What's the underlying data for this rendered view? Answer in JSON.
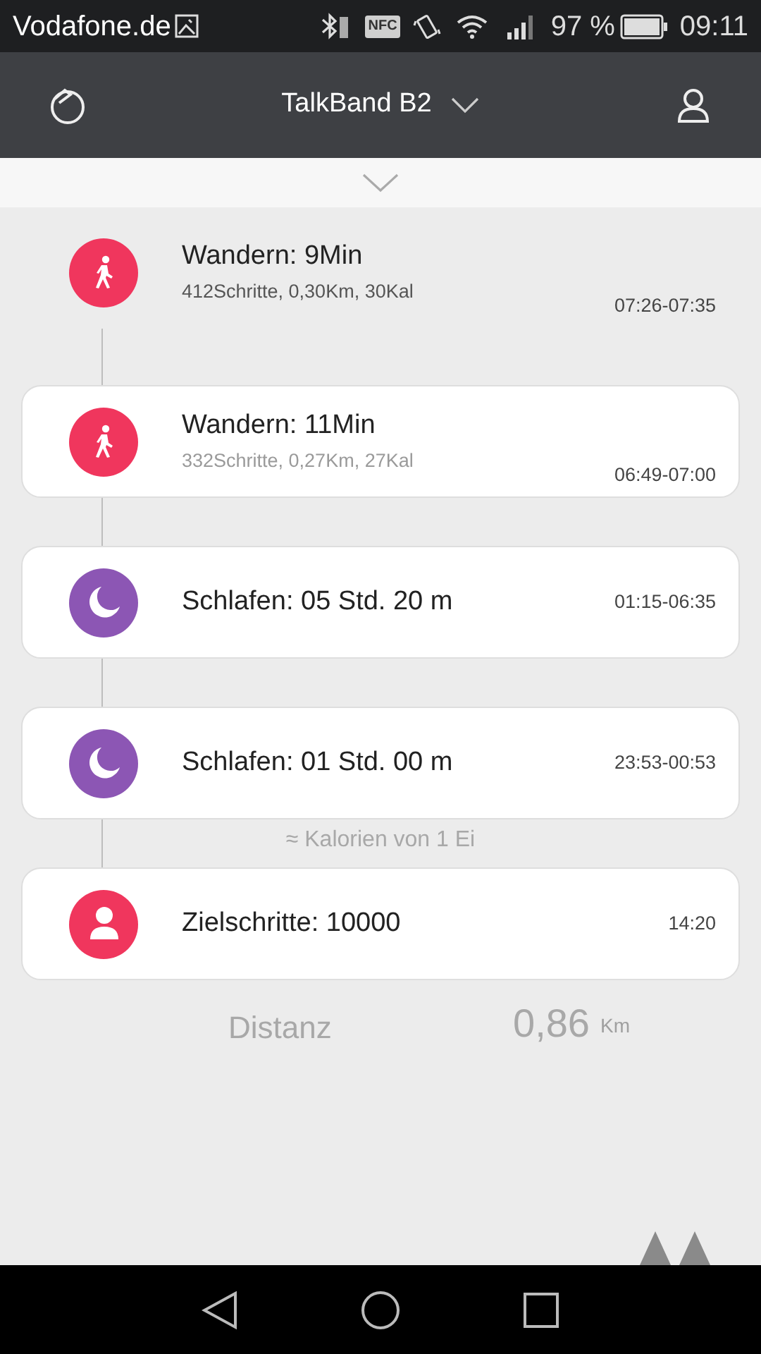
{
  "status_bar": {
    "carrier": "Vodafone.de",
    "nfc_label": "NFC",
    "battery": "97 %",
    "time": "09:11"
  },
  "header": {
    "title": "TalkBand B2"
  },
  "background": {
    "calories_note": "≈ Kalorien von 1 Ei",
    "distance_label": "Distanz",
    "distance_value": "0,86",
    "distance_unit": "Km"
  },
  "timeline": [
    {
      "kind": "walk",
      "carded": false,
      "color": "#f0365d",
      "title": "Wandern: 9Min",
      "detail": "412Schritte, 0,30Km, 30Kal",
      "time": "07:26-07:35"
    },
    {
      "kind": "walk",
      "carded": true,
      "color": "#f0365d",
      "title": "Wandern: 11Min",
      "detail": "332Schritte, 0,27Km, 27Kal",
      "time": "06:49-07:00"
    },
    {
      "kind": "sleep",
      "carded": true,
      "color": "#8c56b4",
      "title": "Schlafen: 05 Std. 20 m",
      "time": "01:15-06:35"
    },
    {
      "kind": "sleep",
      "carded": true,
      "color": "#8c56b4",
      "title": "Schlafen: 01 Std. 00 m",
      "time": "23:53-00:53"
    },
    {
      "kind": "goal",
      "carded": true,
      "color": "#f0365d",
      "title": "Zielschritte: 10000",
      "time": "14:20"
    }
  ]
}
